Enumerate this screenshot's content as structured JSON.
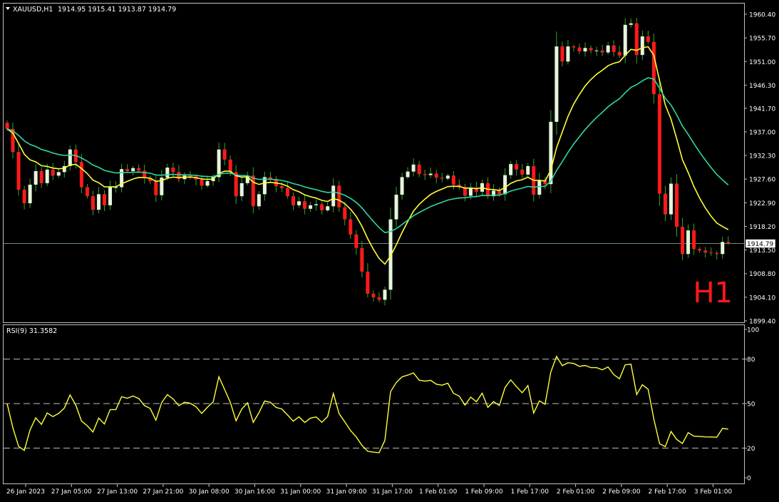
{
  "window": {
    "header_symbol": "XAUUSD,H1",
    "header_ohlc": "1914.95 1915.41 1913.87 1914.79",
    "timeframe_watermark": "H1",
    "current_price_label": "1914.79"
  },
  "colors": {
    "background": "#000000",
    "frame": "#c0c0c0",
    "bull_candle": "#e6f5dc",
    "bear_candle": "#ff1a1a",
    "wick": "#2ea82e",
    "ma_fast": "#ffff3a",
    "ma_slow": "#30d7a0",
    "rsi_line": "#ffff3a",
    "watermark": "#ff1a1a",
    "price_line": "#8fb9a8"
  },
  "chart_data": [
    {
      "type": "candlestick",
      "title": "XAUUSD,H1",
      "y_ticks": [
        "1960.40",
        "1955.70",
        "1951.00",
        "1946.30",
        "1941.70",
        "1937.00",
        "1932.30",
        "1927.60",
        "1922.90",
        "1918.20",
        "1913.50",
        "1908.80",
        "1904.10",
        "1899.40"
      ],
      "ylim": [
        1899.4,
        1960.4
      ],
      "x_tick_labels": [
        "26 Jan 2023",
        "27 Jan 05:00",
        "27 Jan 13:00",
        "27 Jan 21:00",
        "30 Jan 08:00",
        "30 Jan 16:00",
        "31 Jan 00:00",
        "31 Jan 09:00",
        "31 Jan 17:00",
        "1 Feb 01:00",
        "1 Feb 09:00",
        "1 Feb 17:00",
        "2 Feb 01:00",
        "2 Feb 09:00",
        "2 Feb 17:00",
        "3 Feb 01:00"
      ],
      "last_price": 1914.79,
      "close": [
        1937.6,
        1933.0,
        1925.5,
        1922.8,
        1926.5,
        1929.2,
        1926.8,
        1929.5,
        1928.3,
        1929.0,
        1930.2,
        1933.5,
        1931.0,
        1926.0,
        1924.2,
        1921.5,
        1924.6,
        1922.4,
        1926.0,
        1926.0,
        1929.6,
        1929.2,
        1929.8,
        1929.3,
        1927.8,
        1927.2,
        1924.4,
        1927.9,
        1929.9,
        1929.0,
        1927.6,
        1928.3,
        1928.1,
        1927.5,
        1926.3,
        1927.2,
        1928.0,
        1933.5,
        1931.5,
        1929.0,
        1924.2,
        1926.8,
        1928.3,
        1922.2,
        1924.6,
        1928.0,
        1927.6,
        1926.2,
        1925.8,
        1924.2,
        1922.4,
        1923.2,
        1921.7,
        1922.4,
        1922.6,
        1921.4,
        1922.2,
        1926.3,
        1922.0,
        1919.6,
        1916.6,
        1913.9,
        1909.2,
        1904.8,
        1904.1,
        1903.6,
        1905.6,
        1919.6,
        1924.5,
        1928.0,
        1929.1,
        1930.5,
        1928.6,
        1928.4,
        1928.7,
        1927.9,
        1927.7,
        1928.3,
        1926.5,
        1926.0,
        1924.3,
        1925.9,
        1925.1,
        1926.8,
        1924.2,
        1925.3,
        1924.6,
        1928.4,
        1930.6,
        1929.5,
        1928.5,
        1930.2,
        1924.5,
        1927.4,
        1926.6,
        1939.0,
        1954.0,
        1951.0,
        1954.0,
        1953.8,
        1953.0,
        1953.7,
        1953.2,
        1953.2,
        1952.8,
        1954.2,
        1952.9,
        1952.2,
        1958.3,
        1958.6,
        1952.3,
        1956.0,
        1954.9,
        1944.5,
        1924.7,
        1920.6,
        1926.7,
        1918.1,
        1912.7,
        1917.4,
        1913.7,
        1913.4,
        1913.0,
        1912.9,
        1912.7,
        1915.1,
        1914.8
      ]
    },
    {
      "type": "line",
      "title": "RSI(9) 31.3582",
      "y_ticks": [
        "100",
        "80",
        "50",
        "20",
        "0"
      ],
      "levels": [
        20,
        50,
        80
      ],
      "ylim": [
        0,
        100
      ]
    }
  ]
}
